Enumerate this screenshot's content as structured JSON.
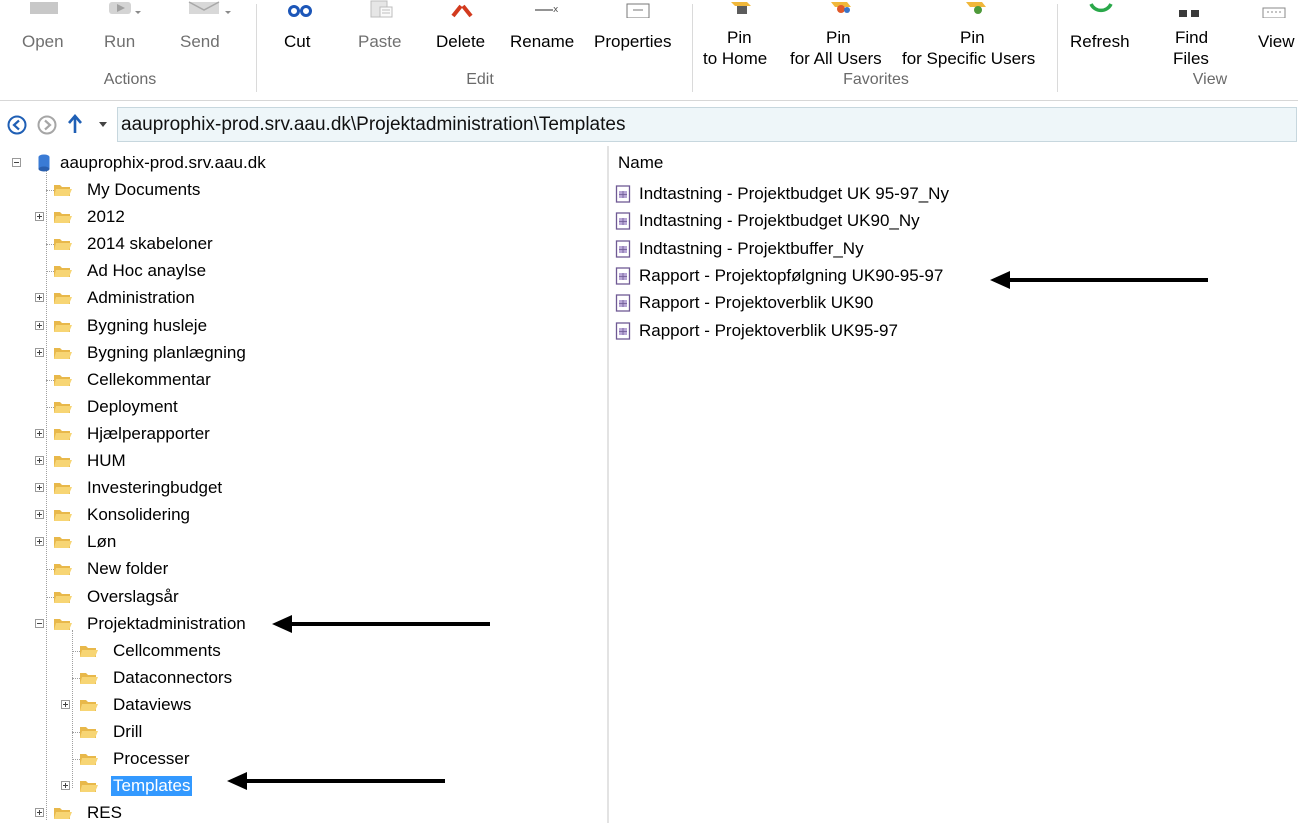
{
  "ribbon": {
    "actions": {
      "open": "Open",
      "run": "Run",
      "send": "Send",
      "group": "Actions"
    },
    "edit": {
      "cut": "Cut",
      "paste": "Paste",
      "delete": "Delete",
      "rename": "Rename",
      "properties": "Properties",
      "group": "Edit"
    },
    "favorites": {
      "pin_home_1": "Pin",
      "pin_home_2": "to Home",
      "pin_all_1": "Pin",
      "pin_all_2": "for All Users",
      "pin_specific_1": "Pin",
      "pin_specific_2": "for Specific Users",
      "group": "Favorites"
    },
    "view": {
      "refresh": "Refresh",
      "find_1": "Find",
      "find_2": "Files",
      "view": "View",
      "group": "View"
    }
  },
  "address": {
    "path": "aauprophix-prod.srv.aau.dk\\Projektadministration\\Templates"
  },
  "tree": {
    "root": "aauprophix-prod.srv.aau.dk",
    "items": [
      "My Documents",
      "2012",
      "2014 skabeloner",
      "Ad Hoc anaylse",
      "Administration",
      "Bygning husleje",
      "Bygning planlægning",
      "Cellekommentar",
      "Deployment",
      "Hjælperapporter",
      "HUM",
      "Investeringbudget",
      "Konsolidering",
      "Løn",
      "New folder",
      "Overslagsår",
      "Projektadministration"
    ],
    "children": [
      "Cellcomments",
      "Dataconnectors",
      "Dataviews",
      "Drill",
      "Processer",
      "Templates"
    ],
    "after": "RES"
  },
  "list": {
    "header": "Name",
    "files": [
      "Indtastning - Projektbudget UK 95-97_Ny",
      "Indtastning - Projektbudget UK90_Ny",
      "Indtastning - Projektbuffer_Ny",
      "Rapport - Projektopfølgning UK90-95-97",
      "Rapport - Projektoverblik UK90",
      "Rapport - Projektoverblik UK95-97"
    ]
  },
  "colors": {
    "selection": "#3399ff",
    "address_bg": "#eef6f9",
    "folder": "#f2c94c"
  }
}
